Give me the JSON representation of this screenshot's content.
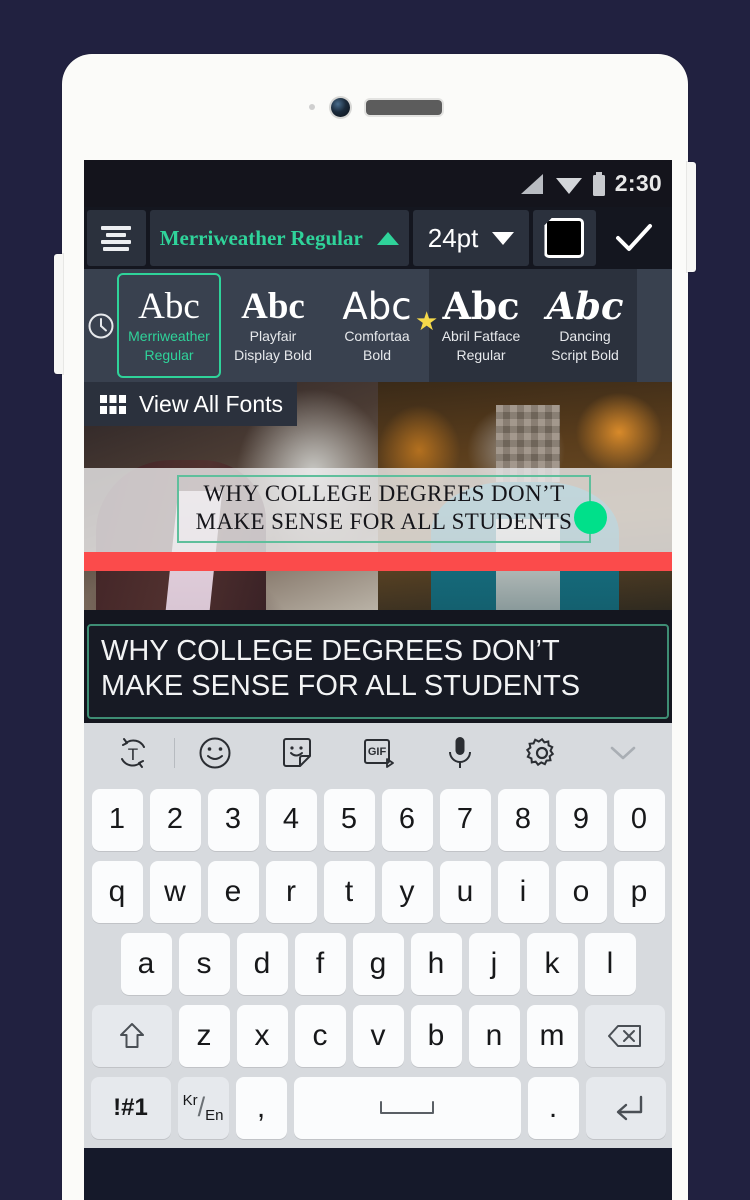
{
  "statusbar": {
    "time": "2:30",
    "icons": [
      "signal-icon",
      "wifi-icon",
      "battery-icon"
    ]
  },
  "toolbar": {
    "align_icon": "text-align-icon",
    "font_name": "Merriweather Regular",
    "font_caret": "caret-up-icon",
    "font_size": "24pt",
    "size_caret": "caret-down-icon",
    "color_swatch": "color-swatch-black",
    "confirm_icon": "checkmark-icon",
    "accent": "#2fd39a"
  },
  "font_carousel": {
    "recent_icon": "clock-icon",
    "fonts": [
      {
        "sample": "Abc",
        "label": "Merriweather\nRegular",
        "label_l1": "Merriweather",
        "label_l2": "Regular",
        "selected": true,
        "starred": false,
        "style": "serif"
      },
      {
        "sample": "Abc",
        "label_l1": "Playfair",
        "label_l2": "Display Bold",
        "selected": false,
        "starred": false,
        "style": "didone"
      },
      {
        "sample": "Abc",
        "label_l1": "Comfortaa",
        "label_l2": "Bold",
        "selected": false,
        "starred": false,
        "style": "round"
      },
      {
        "sample": "Abc",
        "label_l1": "Abril Fatface",
        "label_l2": "Regular",
        "selected": false,
        "starred": true,
        "style": "fat"
      },
      {
        "sample": "Abc",
        "label_l1": "Dancing",
        "label_l2": "Script Bold",
        "selected": false,
        "starred": false,
        "style": "script"
      }
    ]
  },
  "view_all_fonts": {
    "label": "View All Fonts",
    "icon": "grid-icon"
  },
  "preview": {
    "title_line1": "WHY COLLEGE DEGREES DON’T",
    "title_line2": "MAKE SENSE FOR ALL STUDENTS",
    "handle_icon": "resize-handle-dot",
    "handle_color": "#00e08a",
    "accent_bar_color": "#fb4b4b",
    "selection_border_color": "#5fbf9c"
  },
  "editor": {
    "text_line1": "WHY COLLEGE DEGREES DON’T",
    "text_line2": "MAKE SENSE FOR ALL STUDENTS"
  },
  "keyboard": {
    "toolbar_icons": [
      "text-rotate-icon",
      "emoji-icon",
      "sticker-icon",
      "gif-icon",
      "microphone-icon",
      "settings-gear-icon",
      "chevron-down-icon"
    ],
    "gif_label": "GIF",
    "row_numbers": [
      "1",
      "2",
      "3",
      "4",
      "5",
      "6",
      "7",
      "8",
      "9",
      "0"
    ],
    "row_top": [
      "q",
      "w",
      "e",
      "r",
      "t",
      "y",
      "u",
      "i",
      "o",
      "p"
    ],
    "row_home": [
      "a",
      "s",
      "d",
      "f",
      "g",
      "h",
      "j",
      "k",
      "l"
    ],
    "row_bottom": [
      "z",
      "x",
      "c",
      "v",
      "b",
      "n",
      "m"
    ],
    "shift_key": "shift-icon",
    "backspace_key": "backspace-icon",
    "symbols_key": "!#1",
    "language_key_kr": "Kr",
    "language_key_slash": "/",
    "language_key_en": "En",
    "comma_key": ",",
    "space_key": "space-icon",
    "period_key": ".",
    "enter_key": "enter-icon"
  }
}
